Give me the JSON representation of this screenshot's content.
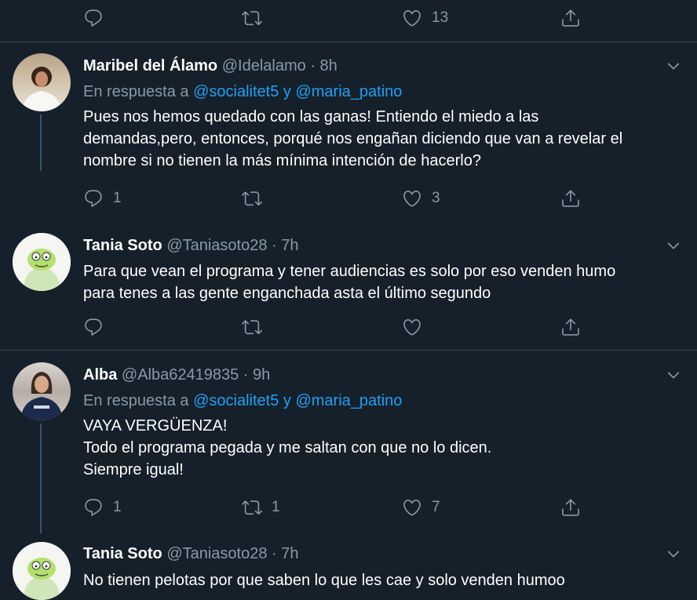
{
  "top_actions": {
    "like_count": "13"
  },
  "tweets": [
    {
      "name": "Maribel del Álamo",
      "handle": "@Idelalamo",
      "dot": "·",
      "time": "8h",
      "reply_prefix": "En respuesta a",
      "reply_mention1": "@socialitet5",
      "reply_joiner": "y",
      "reply_mention2": "@maria_patino",
      "lines": [
        "Pues nos hemos quedado con las ganas! Entiendo el miedo a las",
        "demandas,pero, entonces, porqué nos engañan diciendo que van a revelar el",
        "nombre si no tienen la más mínima intención de hacerlo?"
      ],
      "reply_count": "1",
      "retweet_count": "",
      "like_count": "3"
    },
    {
      "name": "Tania Soto",
      "handle": "@Taniasoto28",
      "dot": "·",
      "time": "7h",
      "lines": [
        "Para que vean el programa y tener audiencias es solo por eso venden humo",
        "para tenes a las gente enganchada asta el último segundo"
      ],
      "reply_count": "",
      "retweet_count": "",
      "like_count": ""
    },
    {
      "name": "Alba",
      "handle": "@Alba62419835",
      "dot": "·",
      "time": "9h",
      "reply_prefix": "En respuesta a",
      "reply_mention1": "@socialitet5",
      "reply_joiner": "y",
      "reply_mention2": "@maria_patino",
      "lines": [
        "VAYA VERGÜENZA!",
        "Todo el programa pegada y me saltan con que no lo dicen.",
        "Siempre igual!"
      ],
      "reply_count": "1",
      "retweet_count": "1",
      "like_count": "7"
    },
    {
      "name": "Tania Soto",
      "handle": "@Taniasoto28",
      "dot": "·",
      "time": "7h",
      "lines": [
        "No tienen pelotas por que saben lo que les cae  y solo venden humoo"
      ]
    }
  ]
}
